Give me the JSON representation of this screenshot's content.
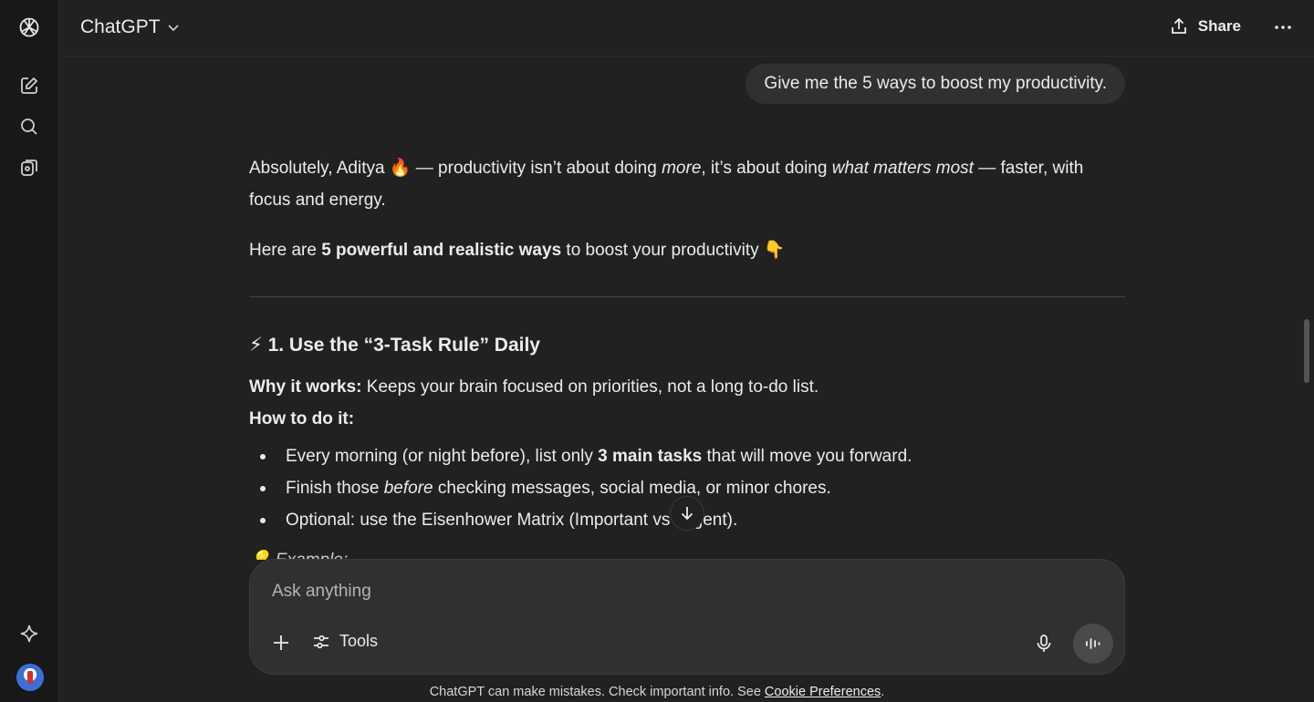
{
  "header": {
    "model_name": "ChatGPT",
    "share_label": "Share"
  },
  "sidebar": {
    "icons": [
      "chatgpt-logo-icon",
      "new-chat-icon",
      "search-icon",
      "library-icon",
      "upgrade-sparkle-icon",
      "avatar"
    ]
  },
  "conversation": {
    "user_message": "Give me the 5 ways to boost my productivity.",
    "intro": {
      "a": "Absolutely, Aditya 🔥 — productivity isn’t about doing ",
      "b": "more",
      "c": ", it’s about doing ",
      "d": "what matters most",
      "e": " — faster, with focus and energy."
    },
    "here_are": {
      "a": "Here are ",
      "b": "5 powerful and realistic ways",
      "c": " to boost your productivity 👇"
    },
    "section_title": "⚡ 1. Use the “3-Task Rule” Daily",
    "why_label": "Why it works:",
    "why_text": " Keeps your brain focused on priorities, not a long to-do list.",
    "how_label": "How to do it:",
    "bullets": [
      {
        "a": "Every morning (or night before), list only ",
        "b": "3 main tasks",
        "c": " that will move you forward."
      },
      {
        "a": "Finish those ",
        "b": "before",
        "c": " checking messages, social media, or minor chores."
      },
      {
        "a": "Optional: use the Eisenhower Matrix (Important vs Urgent).",
        "b": "",
        "c": ""
      }
    ],
    "example_label": "💡 Example:"
  },
  "composer": {
    "placeholder": "Ask anything",
    "tools_label": "Tools"
  },
  "footer": {
    "text": "ChatGPT can make mistakes. Check important info. See ",
    "link": "Cookie Preferences",
    "end": "."
  },
  "colors": {
    "background": "#212121",
    "sidebar": "#181818",
    "bubble": "#303030",
    "text": "#ececec"
  }
}
